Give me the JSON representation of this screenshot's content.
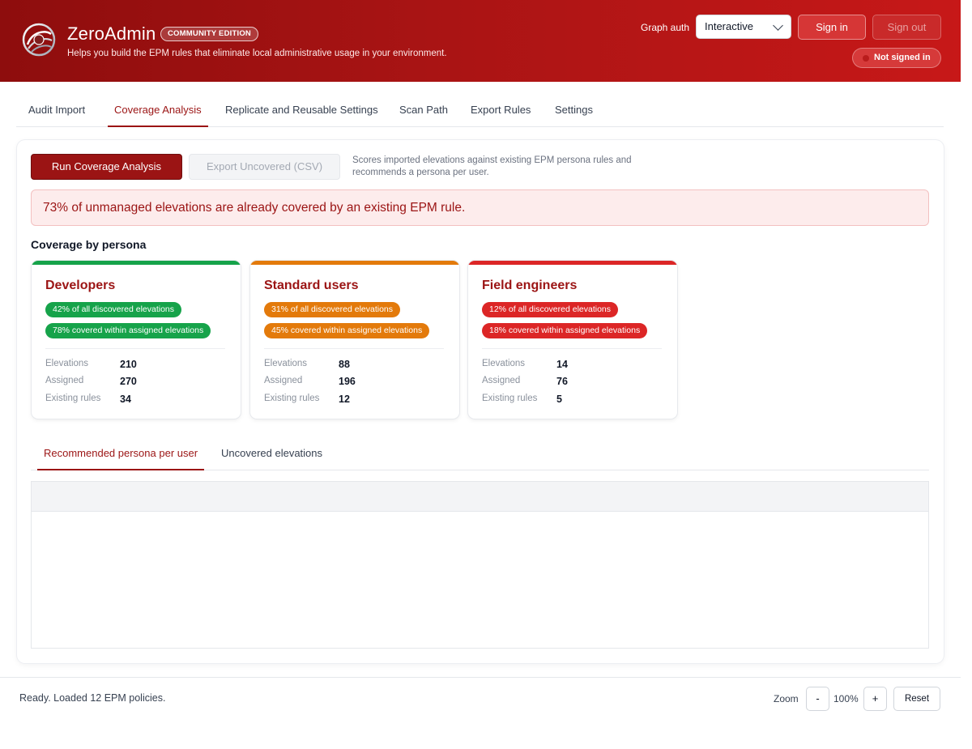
{
  "colors": {
    "brand": "#9b1414",
    "developers": "#16a34a",
    "standard_users": "#e37a0b",
    "field_engineers": "#dc2626"
  },
  "header": {
    "app_name": "ZeroAdmin",
    "edition": "COMMUNITY EDITION",
    "tagline": "Helps you build the EPM rules that eliminate local administrative usage in your environment.",
    "graph_auth_label": "Graph auth",
    "auth_mode": "Interactive",
    "sign_in": "Sign in",
    "sign_out": "Sign out",
    "status": "Not signed in"
  },
  "tabs": [
    {
      "label": "Audit Import"
    },
    {
      "label": "Coverage Analysis"
    },
    {
      "label": "Replicate and Reusable Settings"
    },
    {
      "label": "Scan Path"
    },
    {
      "label": "Export Rules"
    },
    {
      "label": "Settings"
    }
  ],
  "active_tab": "Coverage Analysis",
  "coverage": {
    "run_button": "Run Coverage Analysis",
    "export_button": "Export Uncovered (CSV)",
    "description": "Scores imported elevations against existing EPM persona rules and recommends a persona per user.",
    "summary": "73% of unmanaged elevations are already covered by an existing EPM rule.",
    "section_title": "Coverage by persona",
    "personas": [
      {
        "name": "Developers",
        "pill_discovered": "42% of all discovered elevations",
        "pill_covered": "78% covered within assigned elevations",
        "elevations_label": "Elevations",
        "elevations": "210",
        "assigned_label": "Assigned",
        "assigned": "270",
        "rules_label": "Existing rules",
        "rules": "34"
      },
      {
        "name": "Standard users",
        "pill_discovered": "31% of all discovered elevations",
        "pill_covered": "45% covered within assigned elevations",
        "elevations_label": "Elevations",
        "elevations": "88",
        "assigned_label": "Assigned",
        "assigned": "196",
        "rules_label": "Existing rules",
        "rules": "12"
      },
      {
        "name": "Field engineers",
        "pill_discovered": "12% of all discovered elevations",
        "pill_covered": "18% covered within assigned elevations",
        "elevations_label": "Elevations",
        "elevations": "14",
        "assigned_label": "Assigned",
        "assigned": "76",
        "rules_label": "Existing rules",
        "rules": "5"
      }
    ],
    "subtabs": [
      {
        "label": "Recommended persona per user"
      },
      {
        "label": "Uncovered elevations"
      }
    ]
  },
  "statusbar": {
    "status": "Ready. Loaded 12 EPM policies.",
    "zoom_label": "Zoom",
    "zoom_minus": "-",
    "zoom_value": "100%",
    "zoom_plus": "+",
    "reset": "Reset"
  }
}
